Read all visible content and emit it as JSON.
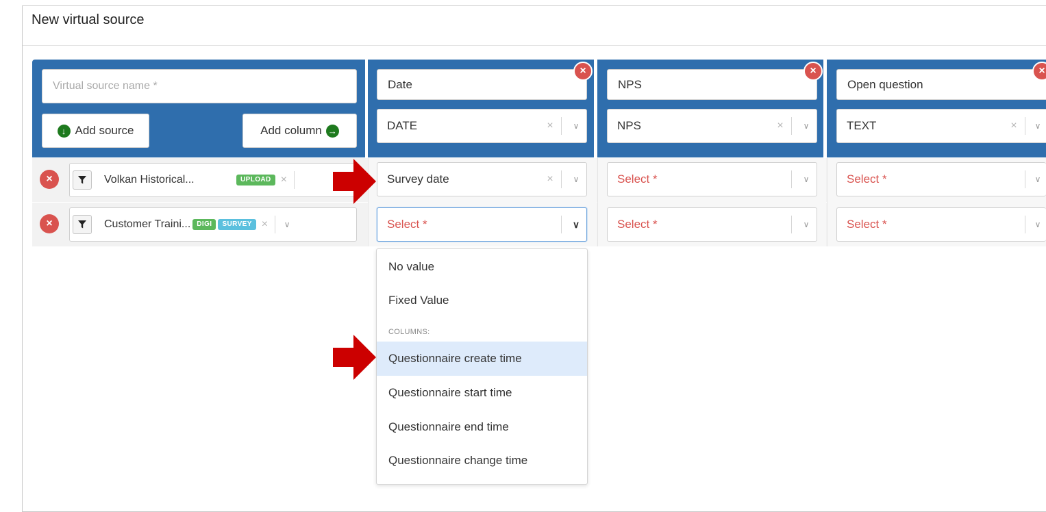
{
  "panel": {
    "title": "New virtual source"
  },
  "source_header": {
    "name_placeholder": "Virtual source name *",
    "add_source_label": "Add source",
    "add_column_label": "Add column"
  },
  "columns": [
    {
      "name": "Date",
      "type": "DATE"
    },
    {
      "name": "NPS",
      "type": "NPS"
    },
    {
      "name": "Open question",
      "type": "TEXT"
    }
  ],
  "sources": [
    {
      "name": "Volkan Historical...",
      "badges": [
        "UPLOAD"
      ],
      "mappings": [
        "Survey date",
        "Select *",
        "Select *"
      ]
    },
    {
      "name": "Customer Traini...",
      "badges": [
        "DIGI",
        "SURVEY"
      ],
      "mappings": [
        "Select *",
        "Select *",
        "Select *"
      ]
    }
  ],
  "dropdown": {
    "options": [
      "No value",
      "Fixed Value"
    ],
    "group_label": "COLUMNS:",
    "column_options": [
      "Questionnaire create time",
      "Questionnaire start time",
      "Questionnaire end time",
      "Questionnaire change time"
    ],
    "highlighted": "Questionnaire create time"
  },
  "colors": {
    "header_blue": "#2f6ead",
    "remove_red": "#d9534f",
    "upload_badge": "#5cb85c",
    "survey_badge": "#5bc0de",
    "annotation_arrow": "#cc0000",
    "highlight": "#deebfb"
  },
  "icons": [
    "plus-circle-icon",
    "arrow-right-circle-icon",
    "close-icon",
    "filter-icon",
    "chevron-down-icon",
    "annotation-arrow"
  ]
}
